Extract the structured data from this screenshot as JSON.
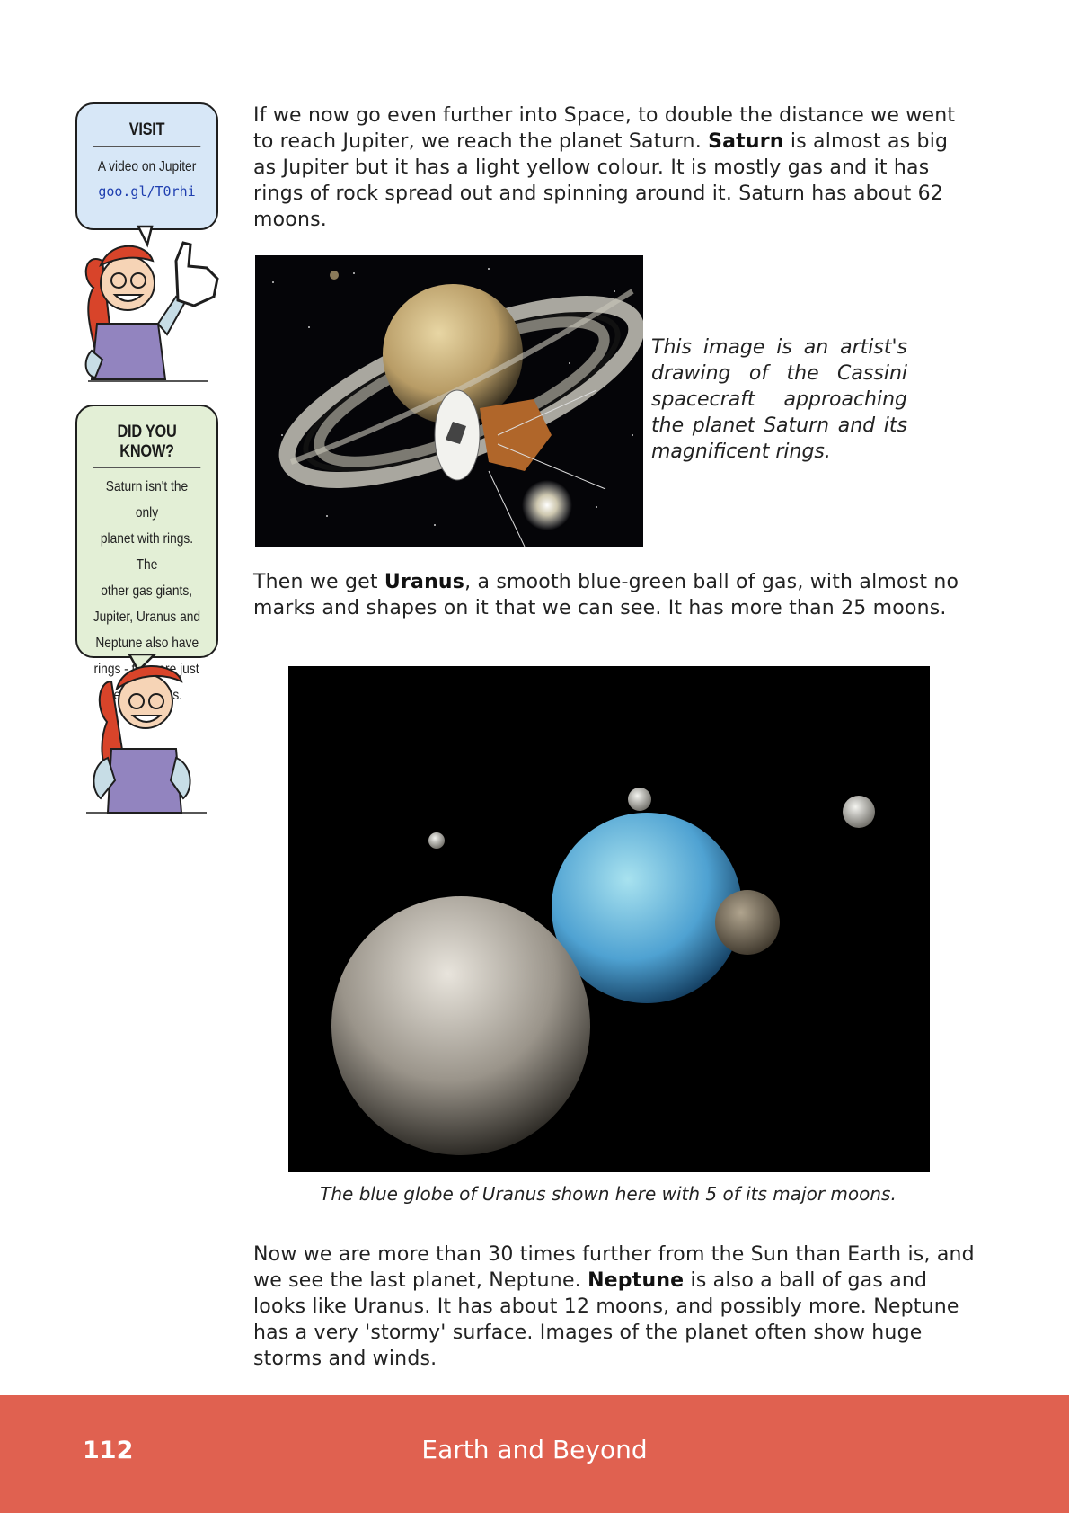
{
  "visit_box": {
    "heading": "VISIT",
    "line": "A video on Jupiter",
    "link": "goo.gl/T0rhi"
  },
  "did_you_know": {
    "heading": "DID YOU KNOW?",
    "lines": [
      "Saturn isn't the only",
      "planet with rings. The",
      "other gas giants,",
      "Jupiter, Uranus and",
      "Neptune also have",
      "rings - they are just",
      "less obvious."
    ]
  },
  "paragraph_saturn": {
    "pre": "If we now go even further into Space, to double the distance we went to reach Jupiter, we reach the planet Saturn. ",
    "bold": "Saturn",
    "post": " is almost as big as Jupiter but it has a light yellow colour. It is mostly gas and it has rings of rock spread out and spinning around it. Saturn has about 62 moons."
  },
  "saturn_caption": "This image is an artist's drawing of the Cassini spacecraft approaching the planet Saturn and its magnificent rings.",
  "paragraph_uranus": {
    "pre": "Then we get ",
    "bold": "Uranus",
    "post": ", a smooth blue-green ball of gas, with almost no marks and shapes on it that we can see. It has more than 25 moons."
  },
  "uranus_caption": "The blue globe of Uranus shown here with 5 of its major moons.",
  "paragraph_neptune": {
    "pre": "Now we are more than 30 times further from the Sun than Earth is, and we see the last planet, Neptune. ",
    "bold": "Neptune",
    "post": " is also a ball of gas and looks like Uranus. It has about 12 moons, and possibly more. Neptune has a very 'stormy' surface. Images of the planet often show huge storms and winds."
  },
  "footer": {
    "page_number": "112",
    "title": "Earth and Beyond"
  }
}
